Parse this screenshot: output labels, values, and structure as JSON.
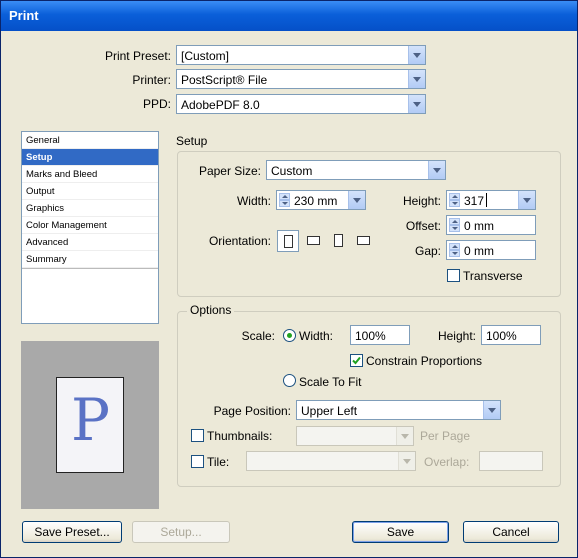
{
  "window": {
    "title": "Print"
  },
  "preset": {
    "print_preset_label": "Print Preset:",
    "print_preset_value": "[Custom]",
    "printer_label": "Printer:",
    "printer_value": "PostScript® File",
    "ppd_label": "PPD:",
    "ppd_value": "AdobePDF 8.0"
  },
  "sidebar": {
    "items": [
      {
        "label": "General"
      },
      {
        "label": "Setup"
      },
      {
        "label": "Marks and Bleed"
      },
      {
        "label": "Output"
      },
      {
        "label": "Graphics"
      },
      {
        "label": "Color Management"
      },
      {
        "label": "Advanced"
      },
      {
        "label": "Summary"
      }
    ],
    "selected_index": 1
  },
  "preview": {
    "letter": "P"
  },
  "setup": {
    "section_title": "Setup",
    "paper_size_label": "Paper Size:",
    "paper_size_value": "Custom",
    "width_label": "Width:",
    "width_value": "230 mm",
    "height_label": "Height:",
    "height_value": "317",
    "offset_label": "Offset:",
    "offset_value": "0 mm",
    "gap_label": "Gap:",
    "gap_value": "0 mm",
    "orientation_label": "Orientation:",
    "transverse_label": "Transverse",
    "transverse_checked": false
  },
  "options": {
    "group_title": "Options",
    "scale_label": "Scale:",
    "width_radio_label": "Width:",
    "width_radio_selected": true,
    "scale_width_value": "100%",
    "height_label": "Height:",
    "scale_height_value": "100%",
    "constrain_label": "Constrain Proportions",
    "constrain_checked": true,
    "scale_to_fit_label": "Scale To Fit",
    "page_position_label": "Page Position:",
    "page_position_value": "Upper Left",
    "thumbnails_label": "Thumbnails:",
    "per_page_label": "Per Page",
    "tile_label": "Tile:",
    "overlap_label": "Overlap:"
  },
  "buttons": {
    "save_preset": "Save Preset...",
    "setup": "Setup...",
    "save": "Save",
    "cancel": "Cancel"
  },
  "colors": {
    "accent": "#316ac5",
    "title_bar": "#0a5fd9",
    "check": "#21a121"
  }
}
